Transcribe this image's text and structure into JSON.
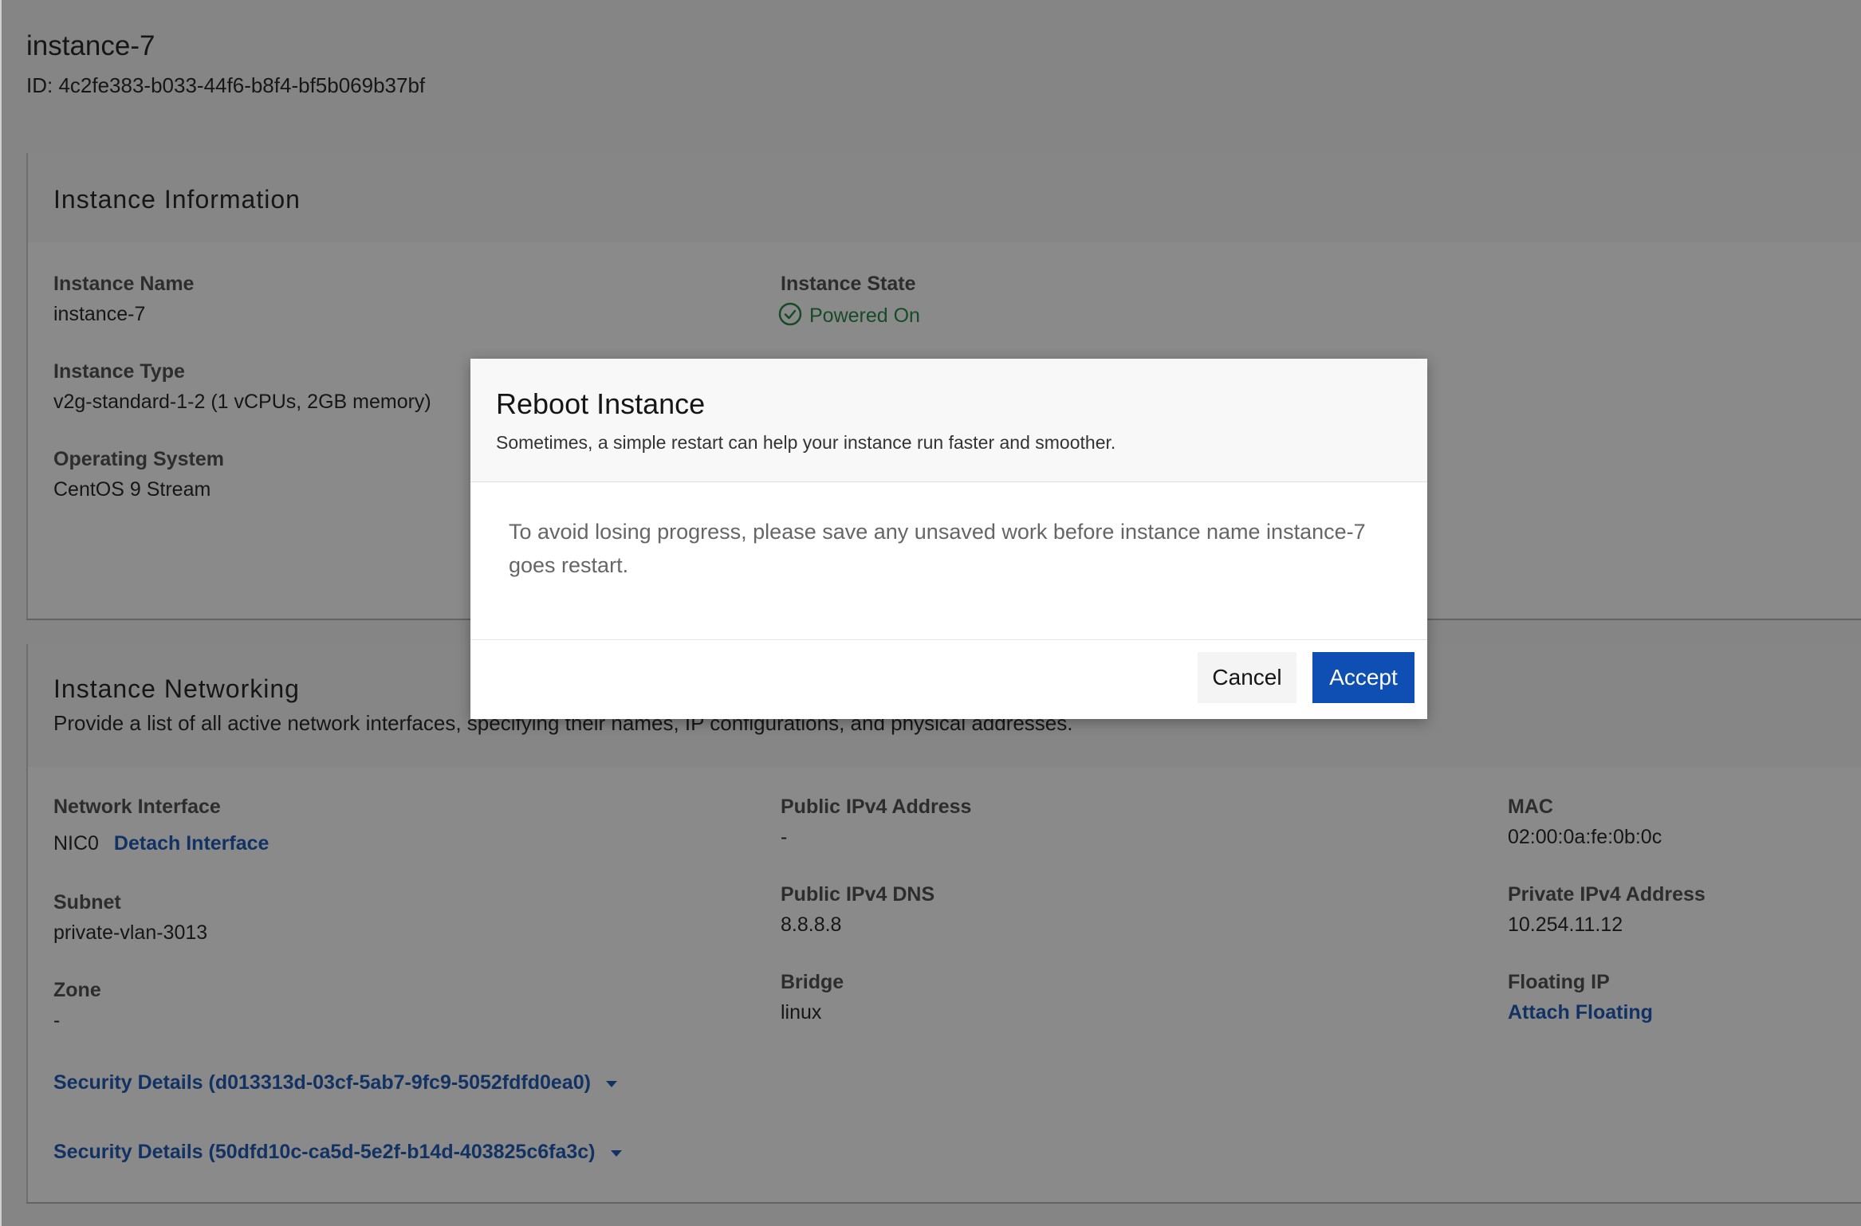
{
  "instance": {
    "title": "instance-7",
    "id_line": "ID: 4c2fe383-b033-44f6-b8f4-bf5b069b37bf"
  },
  "info_card": {
    "title": "Instance Information",
    "fields": {
      "name_label": "Instance Name",
      "name_value": "instance-7",
      "type_label": "Instance Type",
      "type_value": "v2g-standard-1-2 (1 vCPUs, 2GB memory)",
      "os_label": "Operating System",
      "os_value": "CentOS 9 Stream",
      "state_label": "Instance State",
      "state_value": "Powered On",
      "state_icon": "check-circle-icon",
      "state_color": "#198038"
    }
  },
  "networking_card": {
    "title": "Instance Networking",
    "description": "Provide a list of all active network interfaces, specifying their names, IP configurations, and physical addresses.",
    "fields": {
      "nic_label": "Network Interface",
      "nic_value": "NIC0",
      "detach_link": "Detach Interface",
      "subnet_label": "Subnet",
      "subnet_value": "private-vlan-3013",
      "zone_label": "Zone",
      "zone_value": "-",
      "public_ip_label": "Public IPv4 Address",
      "public_ip_value": "-",
      "public_dns_label": "Public IPv4 DNS",
      "public_dns_value": "8.8.8.8",
      "bridge_label": "Bridge",
      "bridge_value": "linux",
      "mac_label": "MAC",
      "mac_value": "02:00:0a:fe:0b:0c",
      "private_ip_label": "Private IPv4 Address",
      "private_ip_value": "10.254.11.12",
      "floating_label": "Floating IP",
      "floating_link": "Attach Floating"
    },
    "security_details": [
      "Security Details (d013313d-03cf-5ab7-9fc9-5052fdfd0ea0)",
      "Security Details (50dfd10c-ca5d-5e2f-b14d-403825c6fa3c)"
    ]
  },
  "modal": {
    "title": "Reboot Instance",
    "subtitle": "Sometimes, a simple restart can help your instance run faster and smoother.",
    "body": "To avoid losing progress, please save any unsaved work before instance name instance-7 goes restart.",
    "cancel_label": "Cancel",
    "accept_label": "Accept",
    "accent_color": "#0f4fb3"
  }
}
